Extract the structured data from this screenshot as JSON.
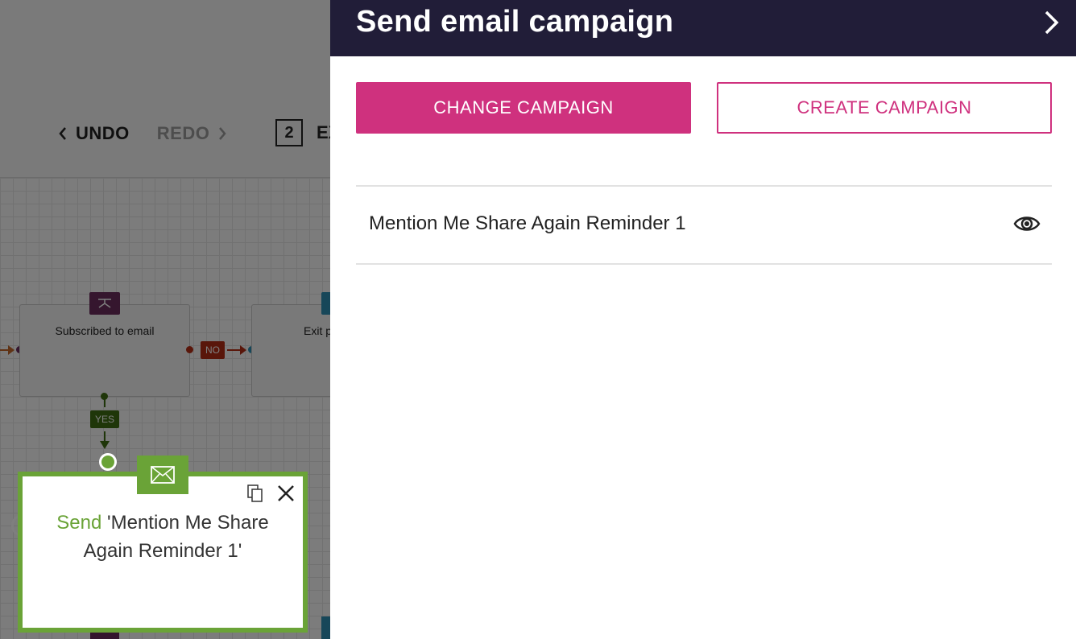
{
  "toolbar": {
    "undo_label": "UNDO",
    "redo_label": "REDO",
    "exit_count": "2",
    "exit_label_partial": "EX"
  },
  "canvas": {
    "nodes": [
      {
        "title": "Subscribed to email",
        "color": "#6a2c5c"
      },
      {
        "title": "Exit p",
        "color": "#2f8fb3"
      }
    ],
    "tags": {
      "no": "NO",
      "yes": "YES"
    },
    "selected_node": {
      "send_word": "Send",
      "campaign_text": "'Mention Me Share Again Reminder 1'",
      "accent": "#6aa337"
    }
  },
  "panel": {
    "title": "Send email campaign",
    "change_button": "CHANGE CAMPAIGN",
    "create_button": "CREATE CAMPAIGN",
    "campaign_name": "Mention Me Share Again Reminder 1",
    "accent": "#cf317e",
    "header_bg": "#211d38"
  }
}
